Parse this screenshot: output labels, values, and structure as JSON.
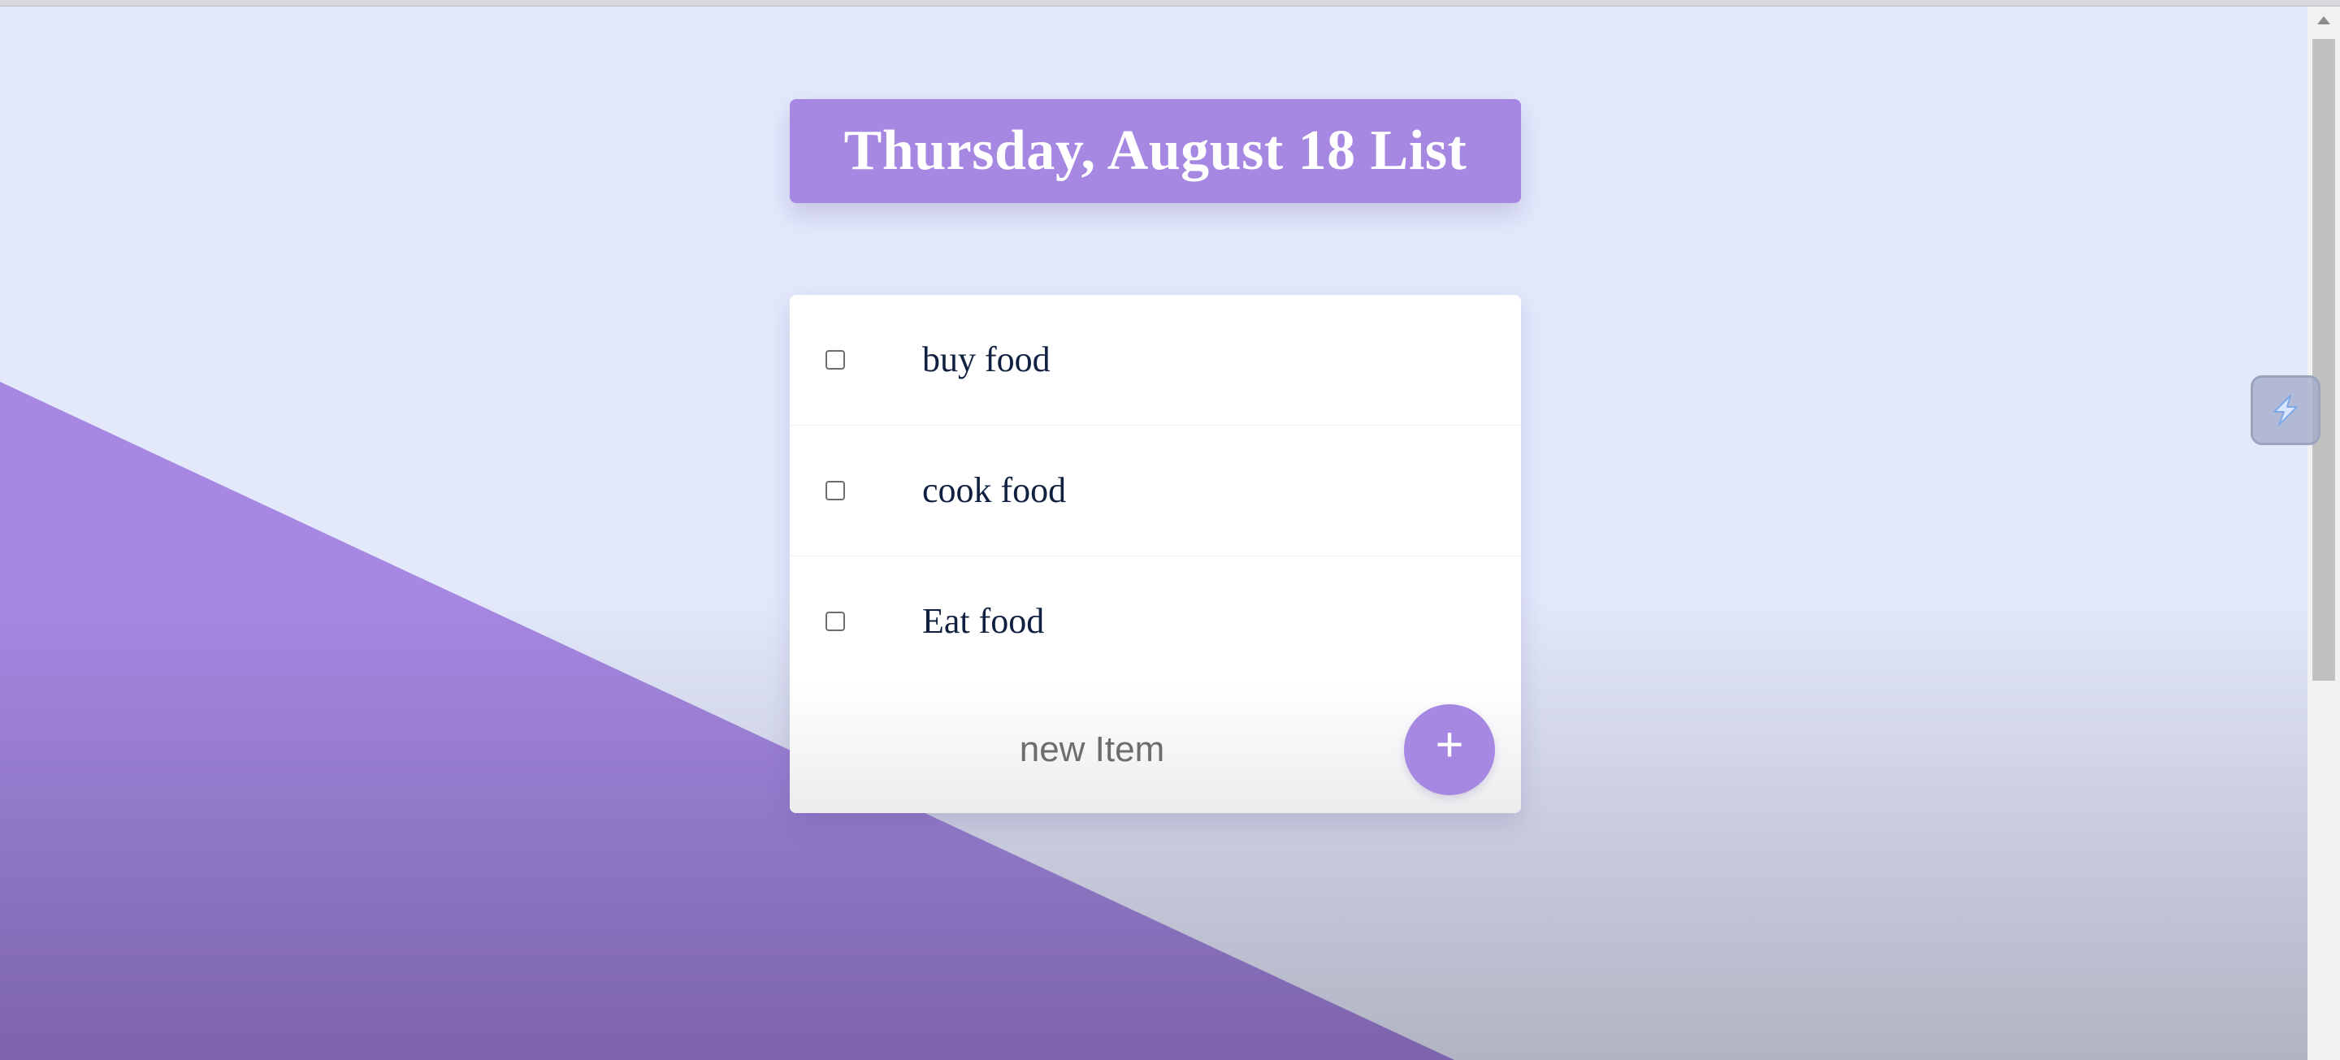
{
  "header": {
    "title": "Thursday, August 18 List"
  },
  "todo": {
    "items": [
      {
        "label": "buy food",
        "checked": false
      },
      {
        "label": "cook food",
        "checked": false
      },
      {
        "label": "Eat food",
        "checked": false
      }
    ],
    "new_item": {
      "placeholder": "new Item",
      "value": ""
    },
    "add_button_label": "+"
  },
  "extension": {
    "icon": "extension-bolt-icon"
  },
  "colors": {
    "accent": "#a687e2",
    "background": "#e3e8fb",
    "card": "#ffffff",
    "item_text": "#102040"
  }
}
